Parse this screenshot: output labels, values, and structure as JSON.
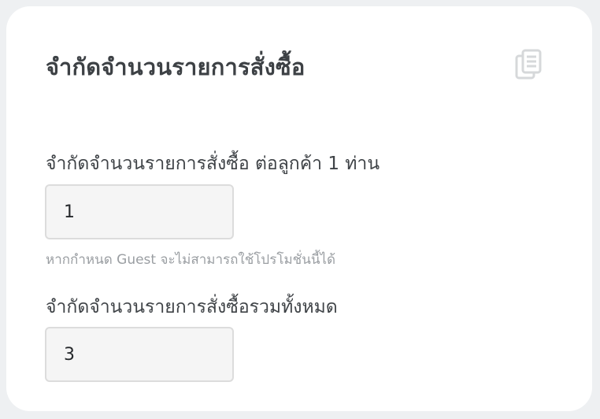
{
  "card": {
    "title": "จำกัดจำนวนรายการสั่งซื้อ",
    "copy_icon": "copy-icon"
  },
  "per_customer": {
    "label": "จำกัดจำนวนรายการสั่งซื้อ ต่อลูกค้า 1 ท่าน",
    "value": "1",
    "hint": "หากกำหนด Guest จะไม่สามารถใช้โปรโมชั่นนี้ได้"
  },
  "total": {
    "label": "จำกัดจำนวนรายการสั่งซื้อรวมทั้งหมด",
    "value": "3"
  },
  "colors": {
    "page_background": "#eef0f2",
    "card_background": "#ffffff",
    "title_text": "#3d4145",
    "input_background": "#f5f5f5",
    "input_border": "#dcdcdc",
    "hint_text": "#9a9ea2",
    "icon": "#d6d8da"
  }
}
